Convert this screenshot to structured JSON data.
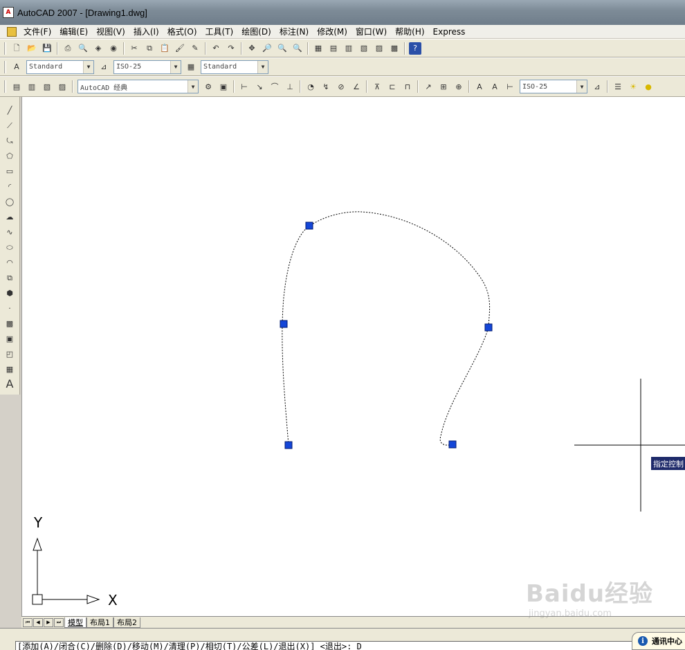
{
  "window": {
    "title": "AutoCAD 2007 - [Drawing1.dwg]",
    "app_icon": "autocad-logo-icon"
  },
  "menu": {
    "items": [
      "文件(F)",
      "编辑(E)",
      "视图(V)",
      "插入(I)",
      "格式(O)",
      "工具(T)",
      "绘图(D)",
      "标注(N)",
      "修改(M)",
      "窗口(W)",
      "帮助(H)",
      "Express"
    ]
  },
  "styles_toolbar": {
    "text_style": "Standard",
    "dim_style": "ISO-25",
    "table_style": "Standard"
  },
  "workspace_toolbar": {
    "workspace": "AutoCAD 经典",
    "dim_style2": "ISO-25"
  },
  "canvas": {
    "tooltip": "指定控制",
    "ucs_x_label": "X",
    "ucs_y_label": "Y",
    "background": "#ffffff",
    "grip_color": "#1446d8"
  },
  "layout_tabs": {
    "tabs": [
      "模型",
      "布局1",
      "布局2"
    ],
    "active": "模型"
  },
  "command_line": {
    "text": "[添加(A)/闭合(C)/删除(D)/移动(M)/清理(P)/相切(T)/公差(L)/退出(X)] <退出>: D"
  },
  "status": {
    "comm_center": "通讯中心"
  },
  "watermark": {
    "brand": "Baidu经验",
    "url": "jingyan.baidu.com"
  }
}
